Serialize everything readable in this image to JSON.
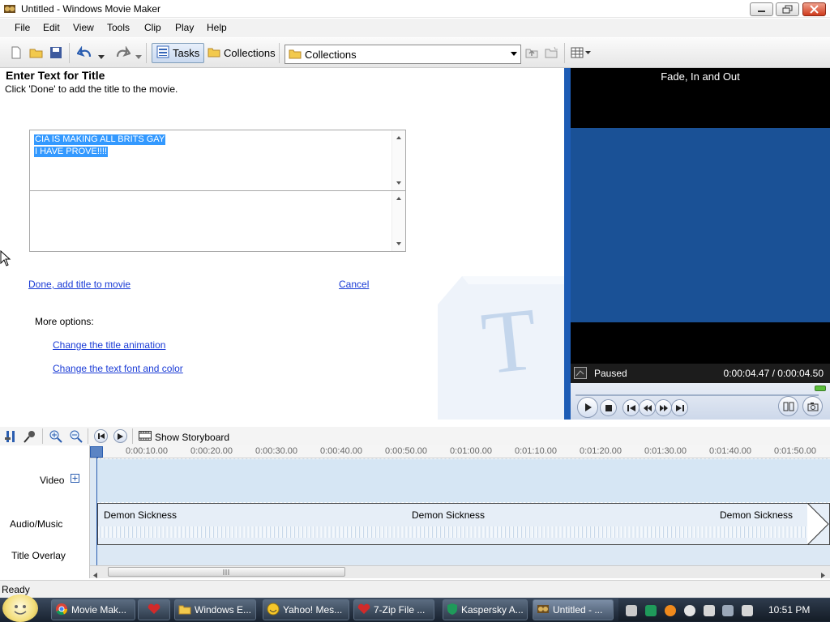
{
  "window": {
    "title": "Untitled - Windows Movie Maker"
  },
  "menu": [
    "File",
    "Edit",
    "View",
    "Tools",
    "Clip",
    "Play",
    "Help"
  ],
  "toolbar": {
    "tasks_label": "Tasks",
    "collections_label": "Collections",
    "collections_dropdown": "Collections"
  },
  "title_pane": {
    "heading": "Enter Text for Title",
    "instruction": "Click 'Done' to add the title to the movie.",
    "text_line1": "CIA IS MAKING ALL BRITS GAY",
    "text_line2": "I HAVE PROVE!!!!",
    "done_link": "Done, add title to movie",
    "cancel_link": "Cancel",
    "more_options": "More options:",
    "option_animation": "Change the title animation",
    "option_font": "Change the text font and color"
  },
  "preview": {
    "title": "Fade, In and Out",
    "state": "Paused",
    "time": "0:00:04.47 / 0:00:04.50"
  },
  "timeline": {
    "show_storyboard": "Show Storyboard",
    "tracks": {
      "video": "Video",
      "audio": "Audio/Music",
      "title_overlay": "Title Overlay"
    },
    "ruler": [
      "0:00:10.00",
      "0:00:20.00",
      "0:00:30.00",
      "0:00:40.00",
      "0:00:50.00",
      "0:01:00.00",
      "0:01:10.00",
      "0:01:20.00",
      "0:01:30.00",
      "0:01:40.00",
      "0:01:50.00"
    ],
    "audio_clips": [
      "Demon Sickness",
      "Demon Sickness",
      "Demon Sickness"
    ]
  },
  "status": {
    "text": "Ready"
  },
  "taskbar": {
    "tasks": [
      "Movie Mak...",
      "Windows E...",
      "Yahoo! Mes...",
      "7-Zip File ...",
      "Kaspersky A...",
      "Untitled - ..."
    ],
    "clock": "10:51 PM"
  },
  "colors": {
    "accent": "#1d5cb5",
    "preview_blue": "#1a5196",
    "link": "#1a3bd6"
  }
}
